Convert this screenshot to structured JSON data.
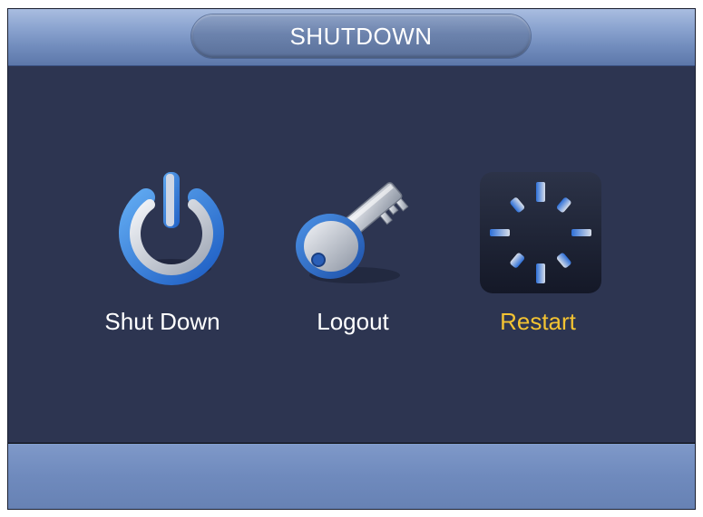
{
  "header": {
    "title": "SHUTDOWN"
  },
  "options": [
    {
      "label": "Shut Down",
      "icon": "power-icon"
    },
    {
      "label": "Logout",
      "icon": "key-icon"
    },
    {
      "label": "Restart",
      "icon": "restart-icon",
      "selected": true
    }
  ],
  "colors": {
    "background": "#2d3551",
    "selected_label": "#f3c332",
    "label": "#ffffff",
    "header": "#8aa3cf"
  }
}
